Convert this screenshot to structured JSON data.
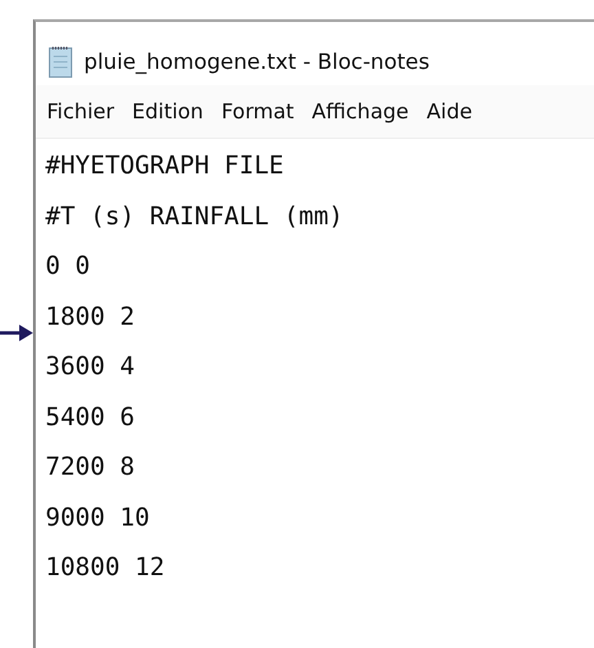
{
  "window": {
    "title": "pluie_homogene.txt - Bloc-notes"
  },
  "menu": [
    "Fichier",
    "Edition",
    "Format",
    "Affichage",
    "Aide"
  ],
  "editor": {
    "lines": [
      "#HYETOGRAPH FILE",
      "#T (s) RAINFALL (mm)",
      "0 0",
      "1800 2",
      "3600 4",
      "5400 6",
      "7200 8",
      "9000 10",
      "10800 12"
    ]
  }
}
